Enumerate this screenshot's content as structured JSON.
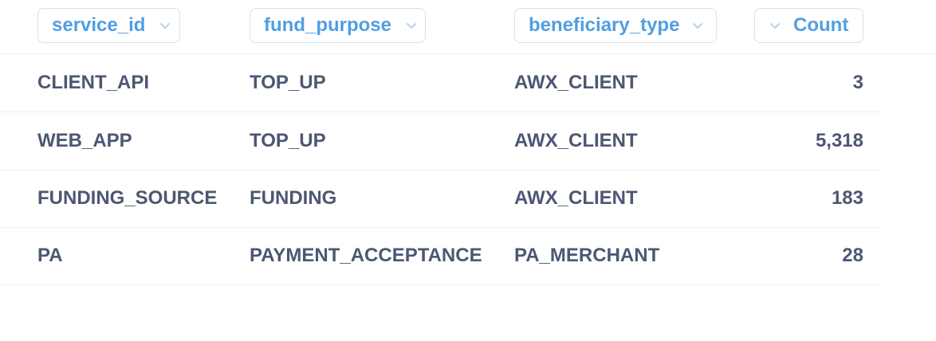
{
  "table": {
    "columns": [
      {
        "key": "service_id",
        "label": "service_id",
        "icon": "chevron-down-icon"
      },
      {
        "key": "fund_purpose",
        "label": "fund_purpose",
        "icon": "chevron-down-icon"
      },
      {
        "key": "beneficiary_type",
        "label": "beneficiary_type",
        "icon": "chevron-down-icon"
      },
      {
        "key": "count",
        "label": "Count",
        "icon": "chevron-down-icon"
      }
    ],
    "rows": [
      {
        "service_id": "CLIENT_API",
        "fund_purpose": "TOP_UP",
        "beneficiary_type": "AWX_CLIENT",
        "count": "3"
      },
      {
        "service_id": "WEB_APP",
        "fund_purpose": "TOP_UP",
        "beneficiary_type": "AWX_CLIENT",
        "count": "5,318"
      },
      {
        "service_id": "FUNDING_SOURCE",
        "fund_purpose": "FUNDING",
        "beneficiary_type": "AWX_CLIENT",
        "count": "183"
      },
      {
        "service_id": "PA",
        "fund_purpose": "PAYMENT_ACCEPTANCE",
        "beneficiary_type": "PA_MERCHANT",
        "count": "28"
      }
    ]
  },
  "colors": {
    "header_text": "#509ee3",
    "header_border": "#cfe3f4",
    "cell_text": "#4c5773",
    "row_divider": "#f0f1f3"
  }
}
